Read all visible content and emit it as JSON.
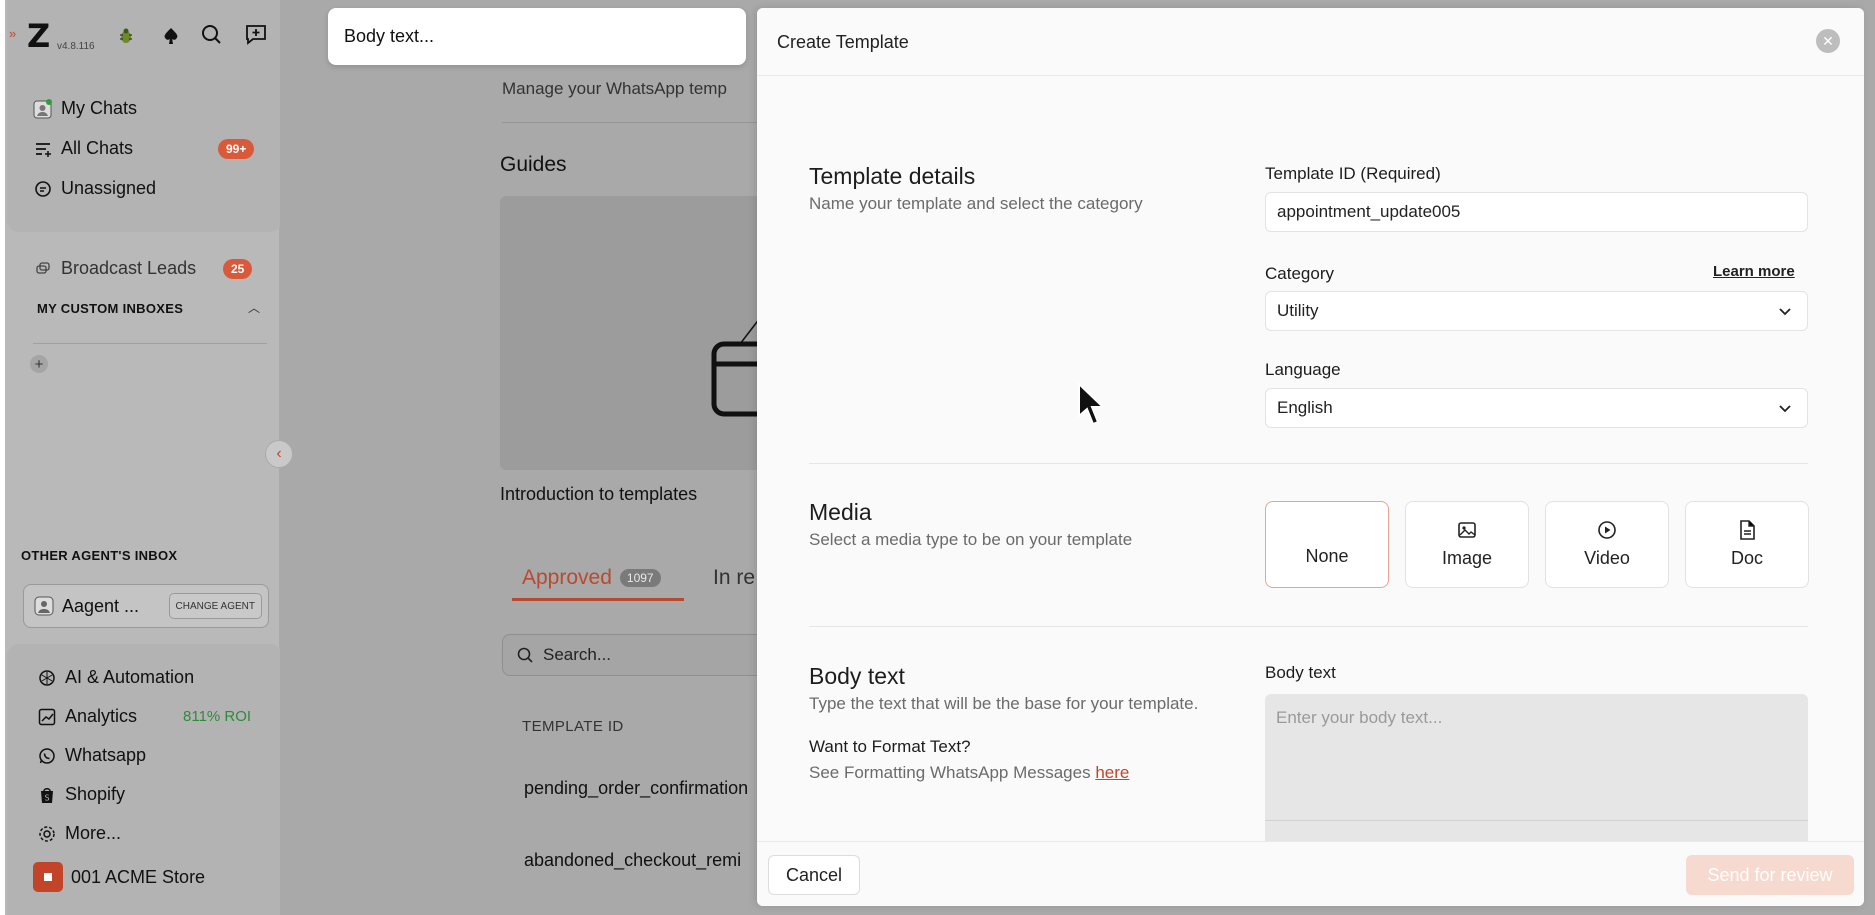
{
  "sidebar": {
    "version": "v4.8.116",
    "top_icons": [
      "bug-icon",
      "spade-icon",
      "search-icon",
      "new-chat-icon"
    ],
    "items": [
      {
        "label": "My Chats",
        "icon": "avatar-icon"
      },
      {
        "label": "All Chats",
        "icon": "filter-icon",
        "badge": "99+"
      },
      {
        "label": "Unassigned",
        "icon": "chat-bubble-icon"
      }
    ],
    "broadcast": {
      "label": "Broadcast Leads",
      "badge": "25"
    },
    "custom_inboxes_heading": "MY CUSTOM INBOXES",
    "other_agents_heading": "OTHER AGENT'S INBOX",
    "agent": {
      "name": "Aagent ...",
      "change_label": "CHANGE AGENT"
    },
    "bottom_items": [
      {
        "label": "AI & Automation",
        "icon": "openai-icon"
      },
      {
        "label": "Analytics",
        "icon": "chart-icon",
        "extra": "811% ROI"
      },
      {
        "label": "Whatsapp",
        "icon": "whatsapp-icon"
      },
      {
        "label": "Shopify",
        "icon": "shopify-icon"
      },
      {
        "label": "More...",
        "icon": "gear-icon"
      }
    ],
    "store": "001 ACME Store"
  },
  "main": {
    "subtitle": "Manage your WhatsApp temp",
    "guides_heading": "Guides",
    "guide_caption": "Introduction to templates",
    "tab_approved": "Approved",
    "tab_approved_count": "1097",
    "tab_in_review": "In re",
    "search_placeholder": "Search...",
    "table_header": "TEMPLATE ID",
    "rows": [
      "pending_order_confirmation",
      "abandoned_checkout_remi"
    ]
  },
  "popup": {
    "text": "Body text..."
  },
  "modal": {
    "title": "Create Template",
    "details": {
      "title": "Template details",
      "subtitle": "Name your template and select the category",
      "template_id_label": "Template ID (Required)",
      "template_id_value": "appointment_update005",
      "category_label": "Category",
      "learn_more": "Learn more",
      "category_value": "Utility",
      "language_label": "Language",
      "language_value": "English"
    },
    "media": {
      "title": "Media",
      "subtitle": "Select a media type to be on your template",
      "options": [
        "None",
        "Image",
        "Video",
        "Doc"
      ],
      "selected": "None"
    },
    "body": {
      "title": "Body text",
      "subtitle": "Type the text that will be the base for your template.",
      "format_heading": "Want to Format Text?",
      "format_text": "See Formatting WhatsApp Messages",
      "format_link": "here",
      "label": "Body text",
      "placeholder": "Enter your body text..."
    },
    "cancel_label": "Cancel",
    "send_label": "Send for review"
  },
  "colors": {
    "accent": "#c2452a",
    "badge": "#d85a3a",
    "roi_green": "#2e8b3a"
  }
}
